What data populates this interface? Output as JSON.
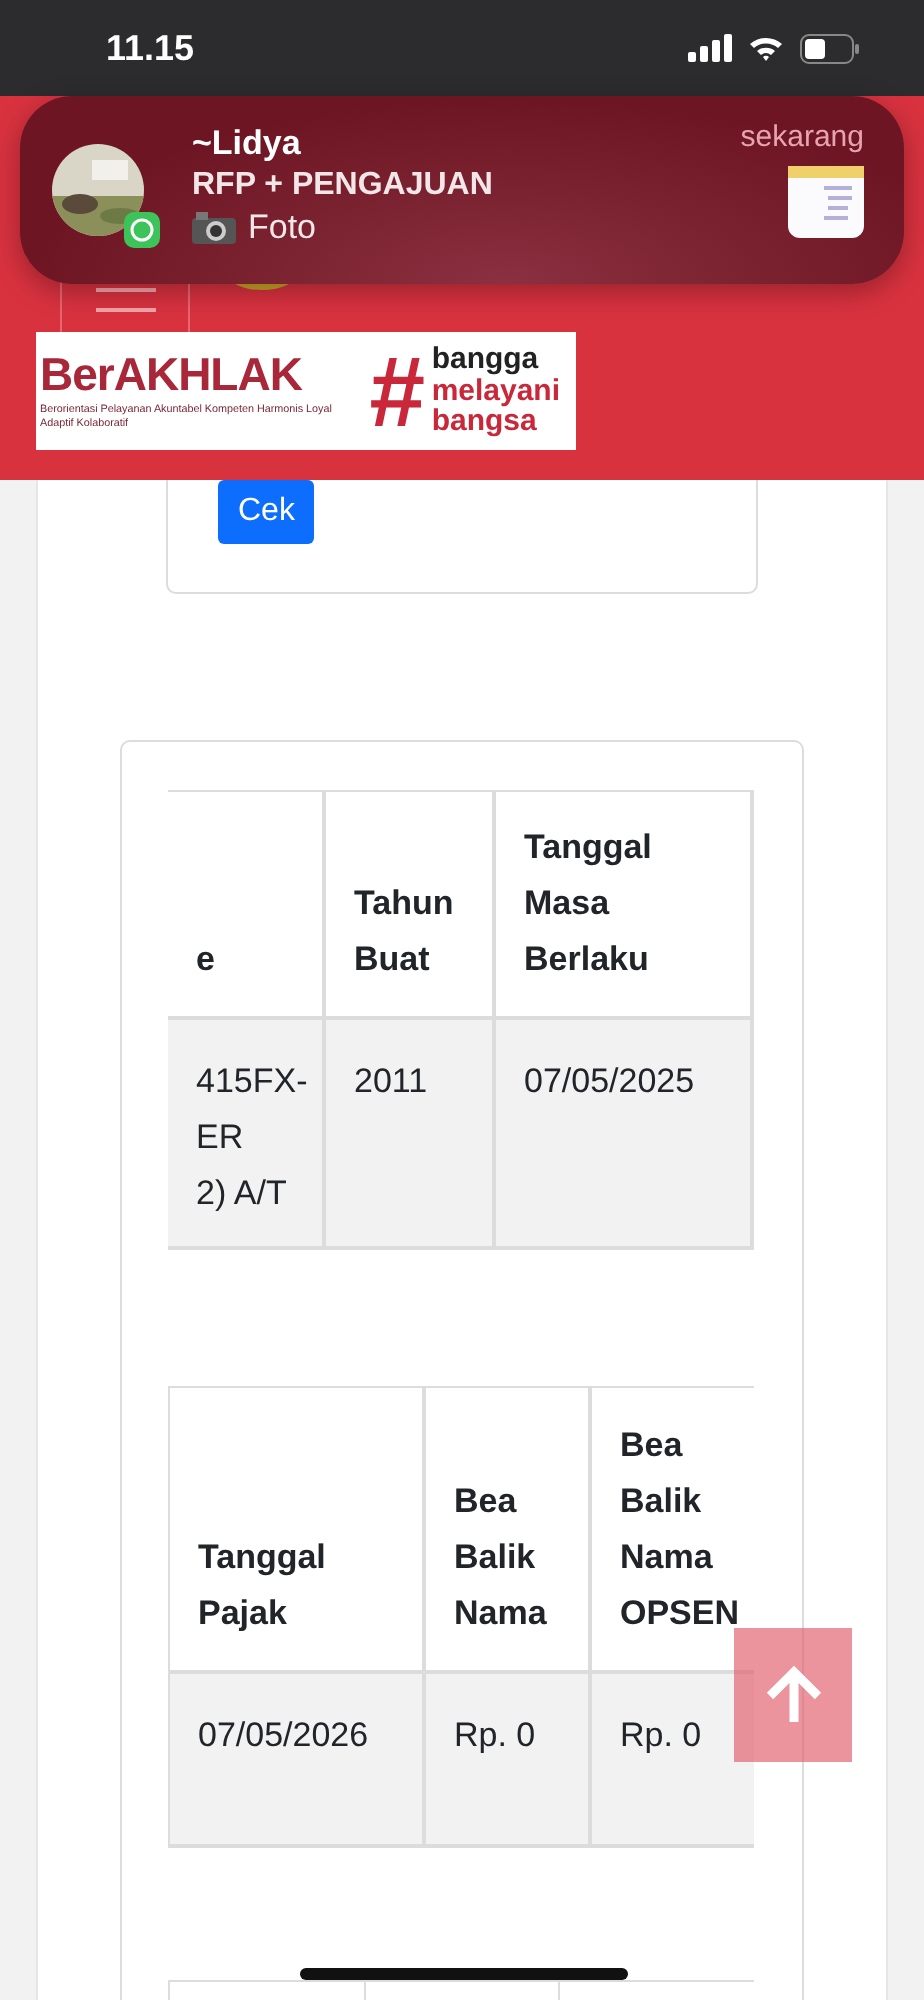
{
  "status_bar": {
    "time": "11.15"
  },
  "notification": {
    "sender": "~Lidya",
    "title": "RFP + PENGAJUAN",
    "message": "Foto",
    "time": "sekarang"
  },
  "banner": {
    "brand": "BerAKHLAK",
    "tagline": "Berorientasi Pelayanan Akuntabel Kompeten Harmonis Loyal Adaptif Kolaboratif",
    "hashtag": "#",
    "slogan": [
      "bangga",
      "melayani",
      "bangsa"
    ]
  },
  "check_button": {
    "label": "Cek"
  },
  "tables": [
    {
      "columns": [
        "e",
        "Tahun Buat",
        "Tanggal Masa Berlaku"
      ],
      "rows": [
        [
          "415FX-\nER\n2) A/T",
          "2011",
          "07/05/2025"
        ]
      ]
    },
    {
      "columns": [
        "Tanggal Pajak",
        "Bea Balik Nama",
        "Bea Balik Nama OPSEN"
      ],
      "rows": [
        [
          "07/05/2026",
          "Rp. 0",
          "Rp. 0"
        ]
      ]
    }
  ]
}
